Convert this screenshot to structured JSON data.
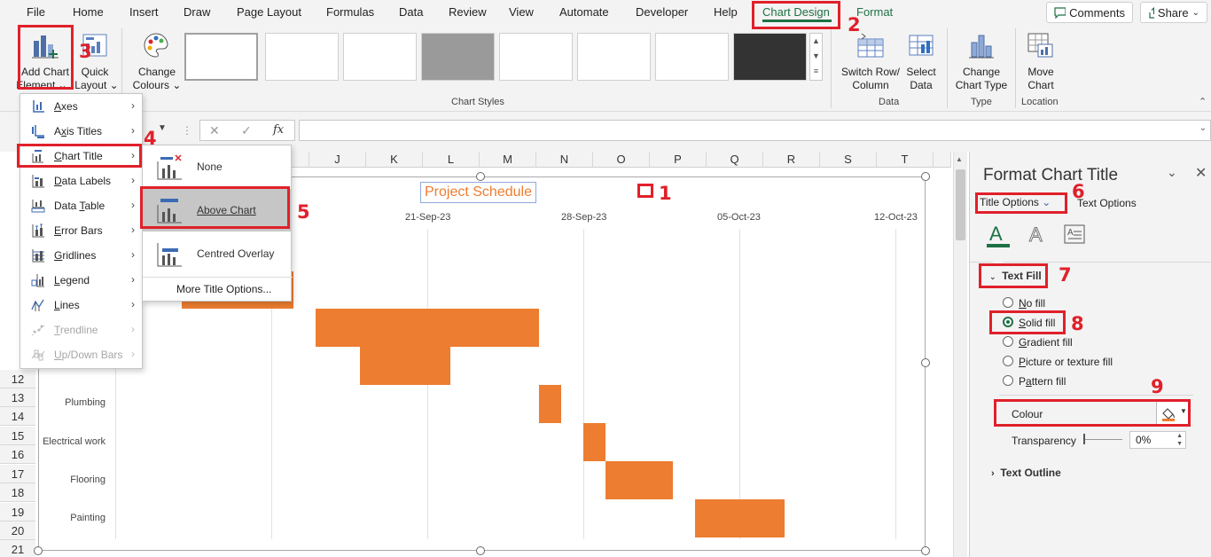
{
  "menu": {
    "tabs": [
      "File",
      "Home",
      "Insert",
      "Draw",
      "Page Layout",
      "Formulas",
      "Data",
      "Review",
      "View",
      "Automate",
      "Developer",
      "Help",
      "Chart Design",
      "Format"
    ],
    "comments": "Comments",
    "share": "Share"
  },
  "ribbon": {
    "add_chart_element": [
      "Add Chart",
      "Element"
    ],
    "quick_layout": [
      "Quick",
      "Layout"
    ],
    "change_colours": [
      "Change",
      "Colours"
    ],
    "chart_styles_label": "Chart Styles",
    "switch_row_column": [
      "Switch Row/",
      "Column"
    ],
    "select_data": [
      "Select",
      "Data"
    ],
    "data_group": "Data",
    "change_chart_type": [
      "Change",
      "Chart Type"
    ],
    "type_group": "Type",
    "move_chart": [
      "Move",
      "Chart"
    ],
    "location_group": "Location"
  },
  "formula_bar": {
    "fx": "fx"
  },
  "columns": [
    "J",
    "K",
    "L",
    "M",
    "N",
    "O",
    "P",
    "Q",
    "R",
    "S",
    "T"
  ],
  "rows": [
    "12",
    "13",
    "14",
    "15",
    "16",
    "17",
    "18",
    "19",
    "20",
    "21"
  ],
  "add_element_menu": [
    {
      "label": "Axes",
      "enabled": true,
      "icon": "axes-icon"
    },
    {
      "label": "Axis Titles",
      "enabled": true,
      "icon": "axis-titles-icon"
    },
    {
      "label": "Chart Title",
      "enabled": true,
      "icon": "chart-title-icon"
    },
    {
      "label": "Data Labels",
      "enabled": true,
      "icon": "data-labels-icon"
    },
    {
      "label": "Data Table",
      "enabled": true,
      "icon": "data-table-icon"
    },
    {
      "label": "Error Bars",
      "enabled": true,
      "icon": "error-bars-icon"
    },
    {
      "label": "Gridlines",
      "enabled": true,
      "icon": "gridlines-icon"
    },
    {
      "label": "Legend",
      "enabled": true,
      "icon": "legend-icon"
    },
    {
      "label": "Lines",
      "enabled": true,
      "icon": "lines-icon"
    },
    {
      "label": "Trendline",
      "enabled": false,
      "icon": "trendline-icon"
    },
    {
      "label": "Up/Down Bars",
      "enabled": false,
      "icon": "up-down-bars-icon"
    }
  ],
  "chart_title_submenu": {
    "none": "None",
    "above_chart": "Above Chart",
    "centred_overlay": "Centred Overlay",
    "more": "More Title Options..."
  },
  "chart": {
    "title": "Project Schedule",
    "dates": [
      "21-Sep-23",
      "28-Sep-23",
      "05-Oct-23",
      "12-Oct-23"
    ],
    "tasks": [
      "Plumbing",
      "Electrical work",
      "Flooring",
      "Painting"
    ],
    "bar_color": "#ed7d31"
  },
  "pane": {
    "title": "Format Chart Title",
    "tab_title_options": "Title Options",
    "tab_text_options": "Text Options",
    "text_fill": "Text Fill",
    "fill_options": [
      "No fill",
      "Solid fill",
      "Gradient fill",
      "Picture or texture fill",
      "Pattern fill"
    ],
    "selected_fill": "Solid fill",
    "colour_label": "Colour",
    "transparency_label": "Transparency",
    "transparency_value": "0%",
    "text_outline": "Text Outline"
  },
  "annotations": [
    "1",
    "2",
    "3",
    "4",
    "5",
    "6",
    "7",
    "8",
    "9"
  ],
  "accent": "#1e7145",
  "annotation_color": "#e0202a"
}
